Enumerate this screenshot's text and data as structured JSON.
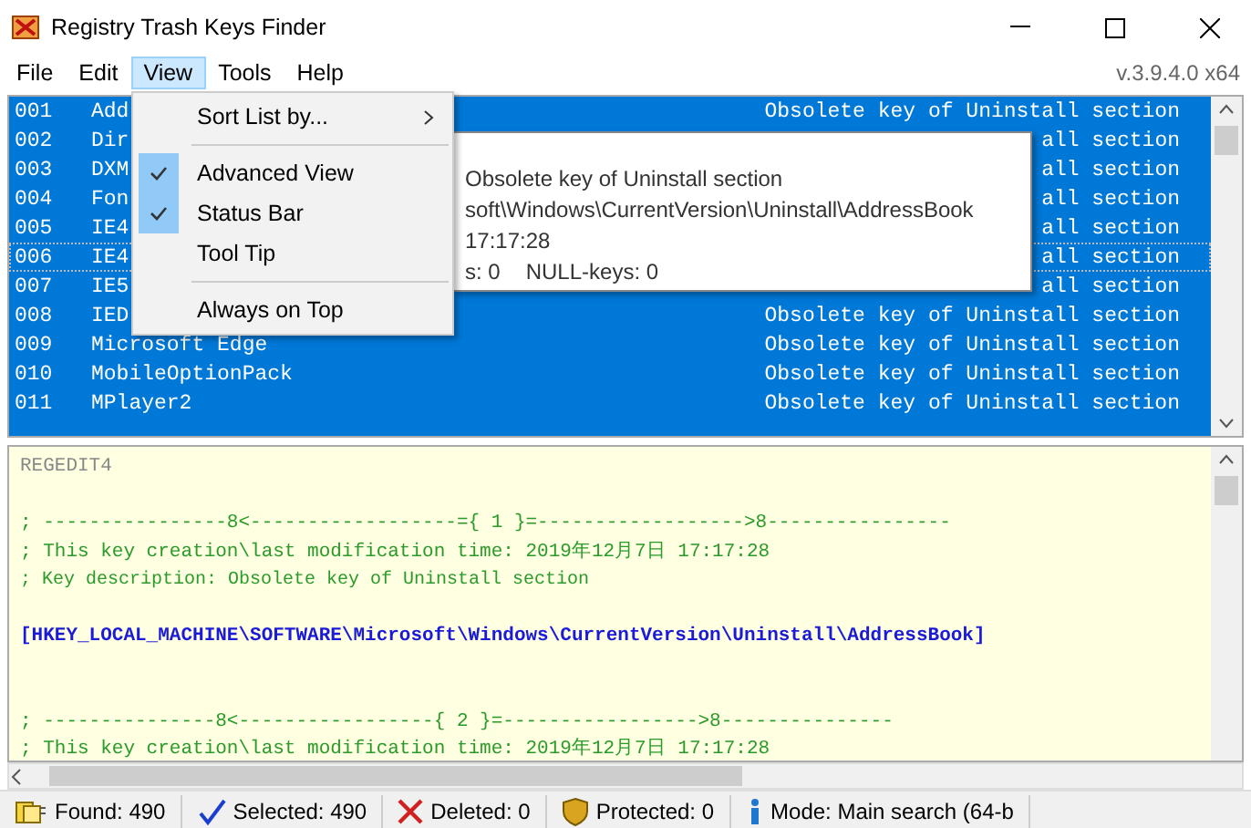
{
  "window": {
    "title": "Registry Trash Keys Finder",
    "version": "v.3.9.4.0 x64"
  },
  "menu_bar": [
    {
      "label": "File",
      "selected": false
    },
    {
      "label": "Edit",
      "selected": false
    },
    {
      "label": "View",
      "selected": true
    },
    {
      "label": "Tools",
      "selected": false
    },
    {
      "label": "Help",
      "selected": false
    }
  ],
  "view_menu": [
    {
      "kind": "item",
      "label": "Sort List by...",
      "submenu": true,
      "checked": false
    },
    {
      "kind": "separator"
    },
    {
      "kind": "item",
      "label": "Advanced View",
      "submenu": false,
      "checked": true
    },
    {
      "kind": "item",
      "label": "Status Bar",
      "submenu": false,
      "checked": true
    },
    {
      "kind": "item",
      "label": "Tool Tip",
      "submenu": false,
      "checked": false
    },
    {
      "kind": "separator"
    },
    {
      "kind": "item",
      "label": "Always on Top",
      "submenu": false,
      "checked": false
    }
  ],
  "rows": [
    {
      "number": "001",
      "name": "Add",
      "description": "Obsolete key of Uninstall section",
      "selected": true,
      "focused": false
    },
    {
      "number": "002",
      "name": "Dir",
      "description": "all section",
      "selected": true,
      "focused": false
    },
    {
      "number": "003",
      "name": "DXM",
      "description": "all section",
      "selected": true,
      "focused": false
    },
    {
      "number": "004",
      "name": "Fon",
      "description": "all section",
      "selected": true,
      "focused": false
    },
    {
      "number": "005",
      "name": "IE4",
      "description": "all section",
      "selected": true,
      "focused": false
    },
    {
      "number": "006",
      "name": "IE4",
      "description": "all section",
      "selected": true,
      "focused": true
    },
    {
      "number": "007",
      "name": "IE5",
      "description": "all section",
      "selected": true,
      "focused": false
    },
    {
      "number": "008",
      "name": "IED",
      "description": "Obsolete key of Uninstall section",
      "selected": true,
      "focused": false
    },
    {
      "number": "009",
      "name": "Microsoft Edge",
      "description": "Obsolete key of Uninstall section",
      "selected": true,
      "focused": false
    },
    {
      "number": "010",
      "name": "MobileOptionPack",
      "description": "Obsolete key of Uninstall section",
      "selected": true,
      "focused": false
    },
    {
      "number": "011",
      "name": "MPlayer2",
      "description": "Obsolete key of Uninstall section",
      "selected": true,
      "focused": false
    }
  ],
  "tooltip": {
    "lines": [
      "Obsolete key of Uninstall section",
      "soft\\Windows\\CurrentVersion\\Uninstall\\AddressBook",
      "17:17:28"
    ],
    "counts": [
      "s: 0",
      "NULL-keys: 0"
    ]
  },
  "editor_lines": [
    {
      "kind": "header",
      "text": "REGEDIT4"
    },
    {
      "kind": "blank"
    },
    {
      "kind": "comment",
      "text": "; ----------------8<------------------={ 1 }=------------------>8----------------"
    },
    {
      "kind": "comment",
      "text": "; This key creation\\last modification time: 2019年12月7日 17:17:28"
    },
    {
      "kind": "note",
      "text": "; Key description: Obsolete key of Uninstall section"
    },
    {
      "kind": "blank"
    },
    {
      "kind": "key",
      "text": "[HKEY_LOCAL_MACHINE\\SOFTWARE\\Microsoft\\Windows\\CurrentVersion\\Uninstall\\AddressBook]"
    },
    {
      "kind": "blank"
    },
    {
      "kind": "blank"
    },
    {
      "kind": "comment",
      "text": "; ---------------8<-----------------{ 2 }=----------------->8---------------"
    },
    {
      "kind": "comment",
      "text": "; This key creation\\last modification time: 2019年12月7日 17:17:28"
    }
  ],
  "status_bar": [
    {
      "kind": "found",
      "text": "Found: 490"
    },
    {
      "kind": "selected",
      "text": "Selected: 490"
    },
    {
      "kind": "deleted",
      "text": "Deleted: 0"
    },
    {
      "kind": "protected",
      "text": "Protected: 0"
    },
    {
      "kind": "mode",
      "text": "Mode: Main search (64-b"
    }
  ]
}
